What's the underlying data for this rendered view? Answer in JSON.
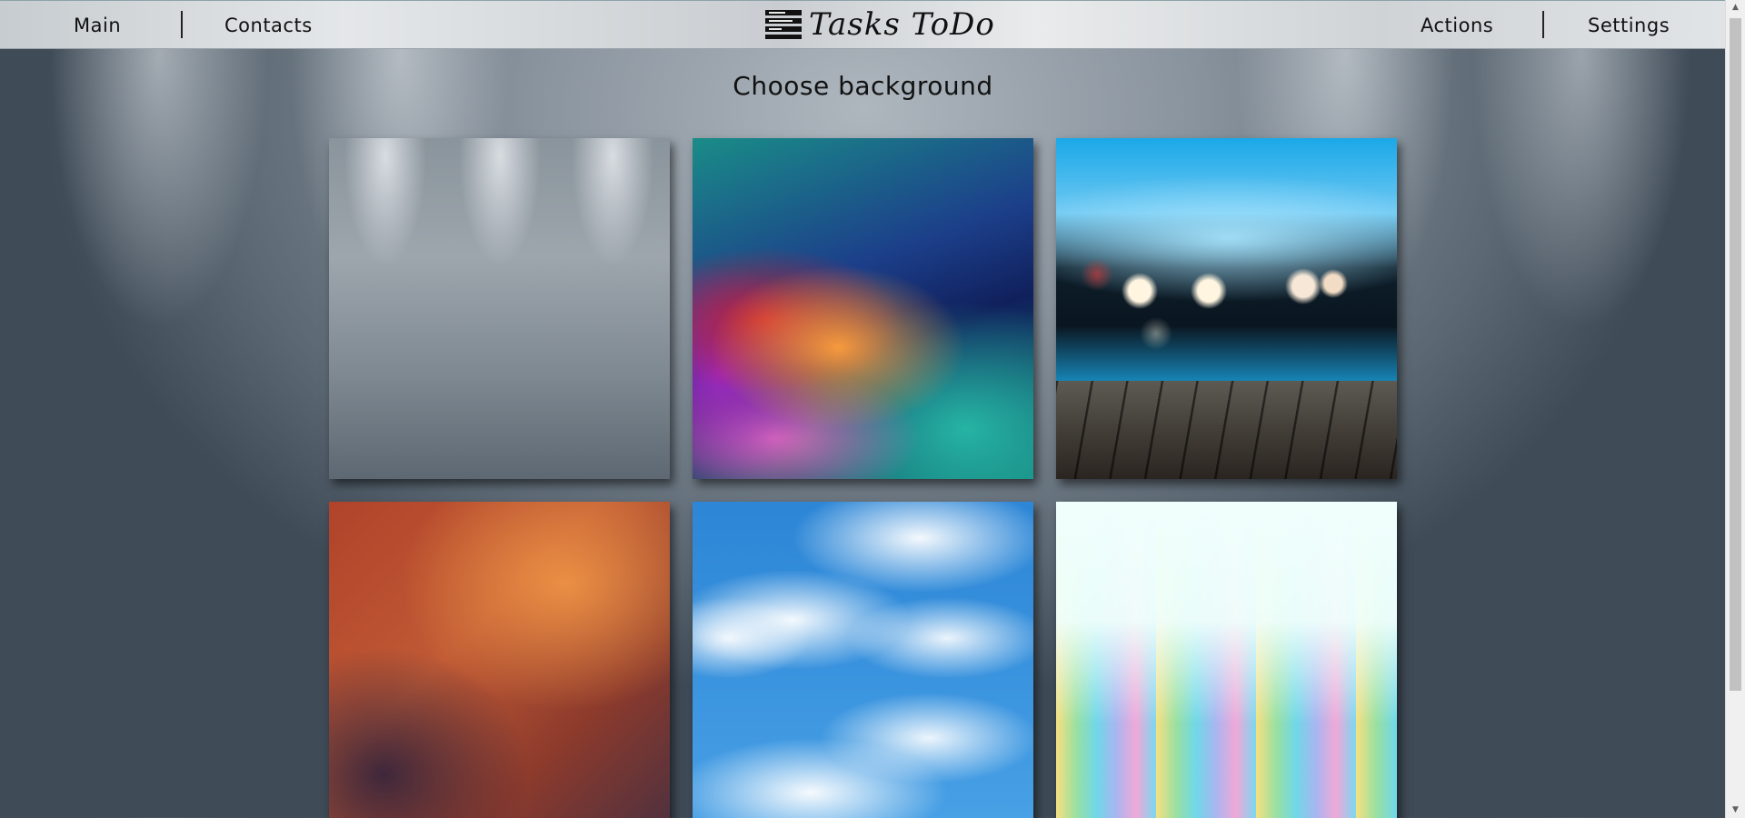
{
  "nav": {
    "main": "Main",
    "contacts": "Contacts",
    "actions": "Actions",
    "settings": "Settings"
  },
  "logo": {
    "text": "Tasks ToDo",
    "icon": "list-icon"
  },
  "page": {
    "heading": "Choose background"
  },
  "backgrounds": [
    {
      "name": "spotlight-gray"
    },
    {
      "name": "rainbow-abstract"
    },
    {
      "name": "bokeh-wooden-floor"
    },
    {
      "name": "rust-texture"
    },
    {
      "name": "cloudy-sky"
    },
    {
      "name": "rainbow-stripes"
    }
  ],
  "colors": {
    "topbar": "#d8dcdf",
    "text": "#111111",
    "page_bg": "#6b7681"
  }
}
